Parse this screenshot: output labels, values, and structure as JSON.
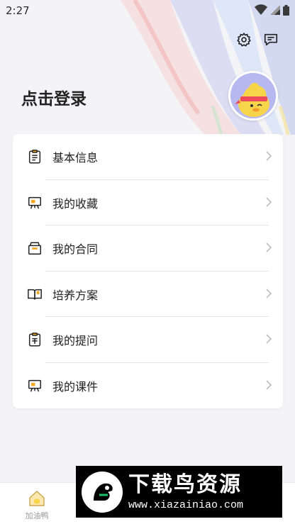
{
  "status_bar": {
    "time": "2:27"
  },
  "header": {
    "login_title": "点击登录"
  },
  "menu": {
    "items": [
      {
        "label": "基本信息",
        "icon": "clipboard-list-icon"
      },
      {
        "label": "我的收藏",
        "icon": "presentation-board-icon"
      },
      {
        "label": "我的合同",
        "icon": "folder-box-icon"
      },
      {
        "label": "培养方案",
        "icon": "open-book-icon"
      },
      {
        "label": "我的提问",
        "icon": "clipboard-question-icon"
      },
      {
        "label": "我的课件",
        "icon": "presentation-board-icon"
      }
    ]
  },
  "bottom_nav": {
    "items": [
      {
        "label": "加油鸭",
        "icon": "home-duck-icon"
      },
      {
        "label": "",
        "icon": ""
      },
      {
        "label": "",
        "icon": ""
      },
      {
        "label": "",
        "icon": ""
      }
    ]
  },
  "watermark": {
    "title": "下载鸟资源",
    "url": "www.xiazainiao.com"
  },
  "colors": {
    "accent": "#f5a623",
    "card_bg": "#ffffff",
    "page_bg": "#f4f4f7",
    "text": "#222222",
    "avatar_bg": "#b7b8ef"
  }
}
